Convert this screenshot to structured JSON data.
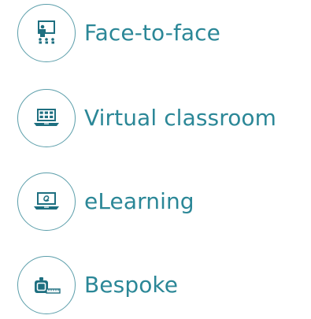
{
  "colors": {
    "accent": "#2b8797",
    "badge_border": "#5b9eaa",
    "icon_fill": "#1e6f80",
    "icon_light": "#ffffff"
  },
  "items": [
    {
      "label": "Face-to-face",
      "icon": "classroom-presentation-icon"
    },
    {
      "label": "Virtual classroom",
      "icon": "laptop-virtual-class-icon"
    },
    {
      "label": "eLearning",
      "icon": "laptop-elearning-icon"
    },
    {
      "label": "Bespoke",
      "icon": "measuring-tape-icon"
    }
  ]
}
